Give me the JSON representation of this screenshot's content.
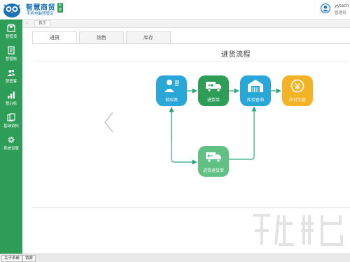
{
  "header": {
    "brand_title": "智慧商贸",
    "brand_subtitle": "手机电脑慧管店",
    "brand_badge": "标准版",
    "user_name": "yytech",
    "user_role": "管理员",
    "icons": [
      "owl-logo-icon",
      "user-avatar-icon"
    ]
  },
  "sidebar": {
    "items": [
      {
        "label": "慧管货",
        "icon": "goods-icon"
      },
      {
        "label": "慧管帐",
        "icon": "ledger-icon"
      },
      {
        "label": "慧管客",
        "icon": "customers-icon"
      },
      {
        "label": "慧分析",
        "icon": "chart-icon"
      },
      {
        "label": "基础资料",
        "icon": "docs-icon"
      },
      {
        "label": "系统设置",
        "icon": "gear-icon"
      }
    ]
  },
  "breadcrumb": {
    "back_symbol": "‹",
    "tab_label": "首页"
  },
  "tabs": [
    {
      "label": "进货",
      "active": true
    },
    {
      "label": "销售",
      "active": false
    },
    {
      "label": "库存",
      "active": false
    }
  ],
  "panel": {
    "title": "进货流程",
    "prev_icon": "chevron-left-icon"
  },
  "flow": {
    "nodes": [
      {
        "label": "供应商",
        "color": "#29a7d9",
        "icon": "supplier-icon"
      },
      {
        "label": "进货单",
        "color": "#2e9d57",
        "icon": "truck-icon"
      },
      {
        "label": "库存查询",
        "color": "#29a7d9",
        "icon": "warehouse-icon"
      },
      {
        "label": "应付欠款",
        "color": "#f4b225",
        "icon": "payment-icon"
      },
      {
        "label": "进货退货单",
        "color": "#61c184",
        "icon": "return-truck-icon"
      }
    ]
  },
  "footer": {
    "about_label": "关于系统",
    "lock_label": "锁屏"
  },
  "colors": {
    "sidebar": "#2e9d57",
    "brand": "#1a73b8"
  }
}
